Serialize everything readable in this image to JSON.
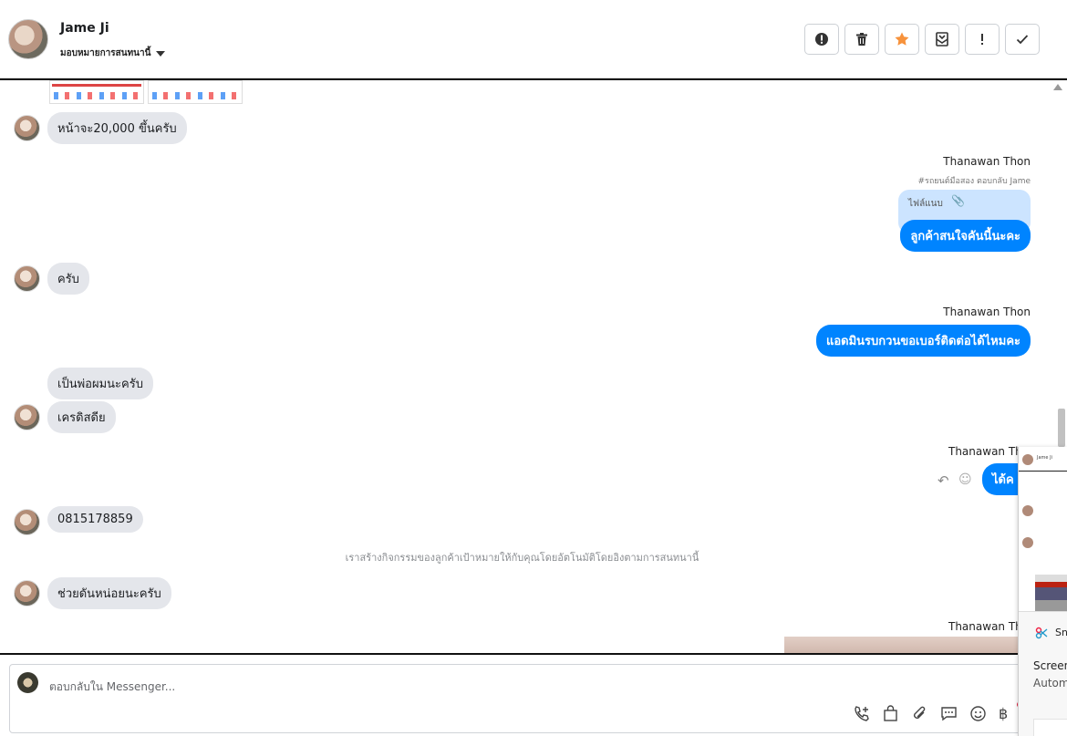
{
  "header": {
    "name": "Jame Ji",
    "assign_label": "มอบหมายการสนทนานี้",
    "actions": [
      "spam-icon",
      "trash-icon",
      "star-icon",
      "mark-unread-icon",
      "important-icon",
      "done-icon"
    ],
    "star_color": "#f7923b"
  },
  "messages": {
    "m1": "หน้าจะ20,000 ขึ้นครับ",
    "s1": "Thanawan Thon",
    "reply_note": "#รถยนต์มือสอง ตอบกลับ Jame",
    "attach_label": "ไฟล์แนบ",
    "o1": "ลูกค้าสนใจคันนี้นะคะ",
    "m2": "ครับ",
    "s2": "Thanawan Thon",
    "o2": "แอดมินรบกวนขอเบอร์ติดต่อได้ไหมคะ",
    "m3": "เป็นพ่อผมนะครับ",
    "m4": "เครดิสดีย",
    "s3": "Thanawan Thon",
    "o3": "ได้ค",
    "m5": "0815178859",
    "system_note": "เราสร้างกิจกรรมของลูกค้าเป้าหมายให้กับคุณโดยอัตโนมัติโดยอิงตามการสนทนานี้",
    "m6": "ช่วยดันหน่อยนะครับ",
    "s4": "Thanawan Thon"
  },
  "composer": {
    "placeholder": "ตอบกลับใน Messenger...",
    "tools": [
      "call-add-icon",
      "bag-icon",
      "paperclip-icon",
      "chat-icon",
      "emoji-icon",
      "baht-icon"
    ]
  },
  "overlay": {
    "mini_name": "Jame Ji",
    "snip_name": "Sn",
    "snip_title": "Screen",
    "snip_sub": "Autom"
  },
  "colors": {
    "outgoing": "#0084ff",
    "incoming": "#e4e6eb",
    "attachment": "#cce4ff"
  }
}
